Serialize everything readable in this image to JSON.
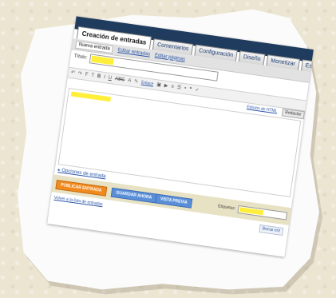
{
  "header": {
    "title": "Creación de entradas",
    "tabs": [
      {
        "label": "Comentarios"
      },
      {
        "label": "Configuración"
      },
      {
        "label": "Diseño"
      },
      {
        "label": "Monetizar"
      },
      {
        "label": "Estad"
      }
    ]
  },
  "subtabs": {
    "active": "Nueva entrada",
    "links": [
      "Editar entradas",
      "Editar páginas"
    ]
  },
  "form": {
    "title_label": "Título:"
  },
  "toolbar": {
    "link_label": "Enlace",
    "edit_html_label": "Edición de HTML",
    "compose_label": "Redactar"
  },
  "options_link": "▸ Opciones de entrada",
  "actions": {
    "publish": "PUBLICAR ENTRADA",
    "save_draft": "GUARDAR AHORA",
    "preview": "VISTA PREVIA",
    "labels_label": "Etiquetas:"
  },
  "footer": {
    "back_link": "Volver a la lista de entradas",
    "save_now": "Borrar ent"
  },
  "colors": {
    "header": "#1f3b5e",
    "publish": "#f08a1e",
    "blue_button": "#5a8fd8",
    "highlight": "#ffef3a"
  }
}
